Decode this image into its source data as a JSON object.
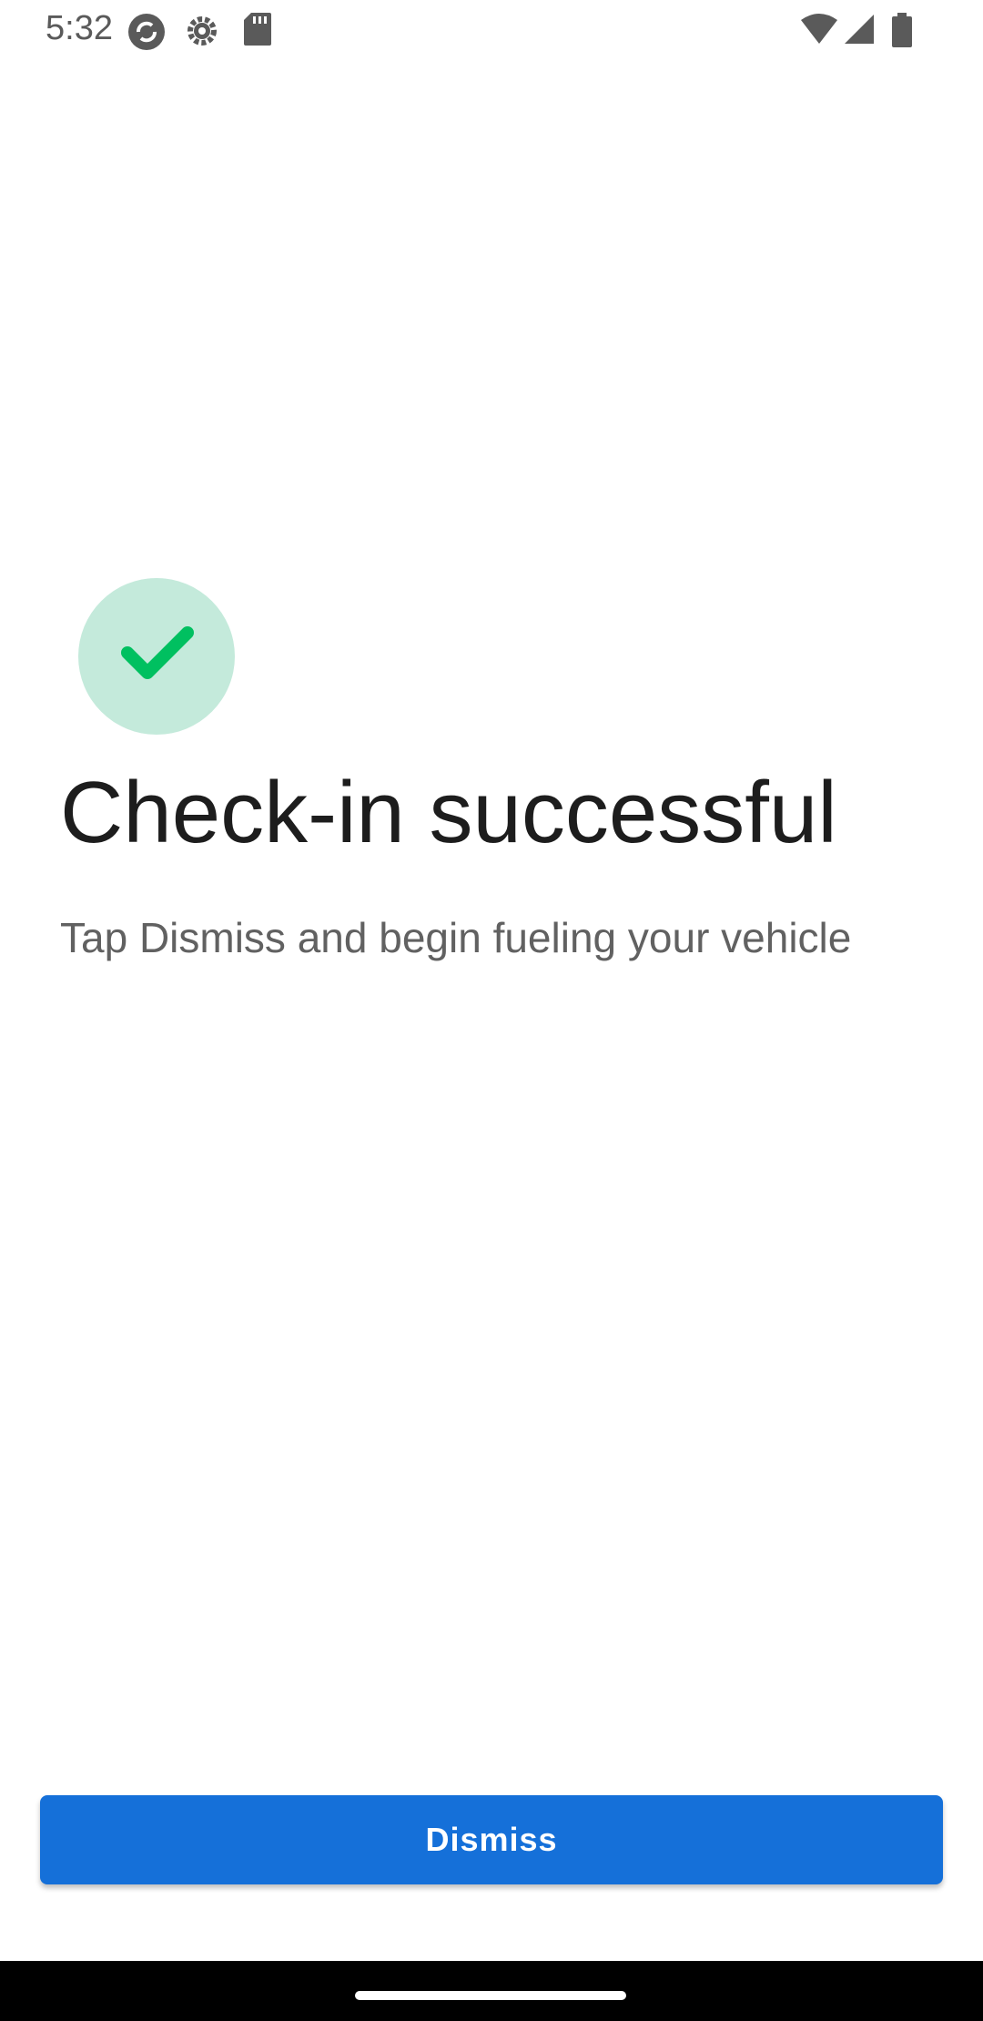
{
  "status_bar": {
    "time": "5:32",
    "icons_left": [
      "sync-icon",
      "settings-icon",
      "sd-card-icon"
    ],
    "icons_right": [
      "wifi-icon",
      "cellular-signal-icon",
      "battery-icon"
    ]
  },
  "content": {
    "success_icon": "checkmark-icon",
    "success_color": "#00c060",
    "success_bg": "#c4eadb",
    "title": "Check-in successful",
    "subtitle": "Tap Dismiss and begin fueling your vehicle"
  },
  "actions": {
    "dismiss_label": "Dismiss",
    "dismiss_color": "#1570d9"
  }
}
